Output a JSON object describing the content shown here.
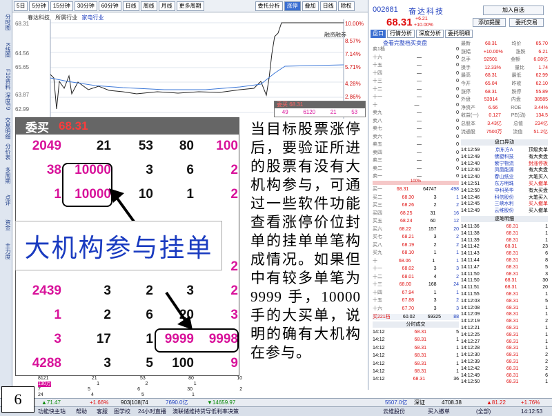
{
  "toolbar": {
    "buttons": [
      "分时",
      "5日",
      "5分钟",
      "15分钟",
      "30分钟",
      "60分钟",
      "日线",
      "周线",
      "月线",
      "更多周期"
    ],
    "right_buttons": [
      "委托分析",
      "涨停",
      "叠加",
      "日线",
      "除权"
    ]
  },
  "left_tabs": [
    "应用",
    "分时图",
    "K线图",
    "F10资料",
    "深度F9",
    "交易明细",
    "分价表",
    "多周期",
    "点评",
    "资金",
    "主力度"
  ],
  "chart": {
    "header": [
      "春达科技",
      "所属行业",
      "家电行业"
    ],
    "price_axis": [
      "68.31",
      "66.48",
      "64.66",
      "62.83",
      "60.95",
      "59.12",
      "57.30"
    ],
    "pct_axis": [
      "10.00%",
      "7.14%",
      "5.71%",
      "4.28%",
      "2.86%"
    ],
    "left_axis_shown": [
      "68.31",
      "66.48",
      "64.56",
      "65.65",
      "63.87",
      "62.99"
    ],
    "right_axis_shown": [
      "10.00%",
      "8.57%",
      "7.14%",
      "5.71%",
      "4.28%",
      "2.86%"
    ],
    "overlay_label": "融资融券",
    "mini_header": "委买  68.31",
    "mini_row": [
      "49",
      "6120",
      "21",
      "53"
    ]
  },
  "stock": {
    "code": "002681",
    "name": "奋达科技",
    "price": "68.31",
    "change": "+6.21",
    "change_pct": "+10.00%",
    "buttons": [
      "加入自选",
      "添加提醒",
      "委托交易"
    ],
    "tabs": [
      "盘口",
      "行情分析",
      "深度分析",
      "委托明细"
    ],
    "detail_link": "查看完整档买卖盘"
  },
  "order_book": {
    "sell_rows": [
      {
        "label": "卖1档",
        "price": "",
        "vol": "0",
        "sz": ""
      },
      {
        "label": "十六",
        "price": "—",
        "vol": "0",
        "sz": ""
      },
      {
        "label": "十五",
        "price": "—",
        "vol": "0",
        "sz": ""
      },
      {
        "label": "十四",
        "price": "—",
        "vol": "0",
        "sz": ""
      },
      {
        "label": "十三",
        "price": "—",
        "vol": "0",
        "sz": ""
      },
      {
        "label": "十二",
        "price": "—",
        "vol": "0",
        "sz": ""
      },
      {
        "label": "十一",
        "price": "—",
        "vol": "0",
        "sz": ""
      },
      {
        "label": "十",
        "price": "—",
        "vol": "0",
        "sz": ""
      },
      {
        "label": "卖九",
        "price": "—",
        "vol": "0",
        "sz": ""
      },
      {
        "label": "卖八",
        "price": "—",
        "vol": "0",
        "sz": ""
      },
      {
        "label": "卖七",
        "price": "—",
        "vol": "0",
        "sz": ""
      },
      {
        "label": "卖六",
        "price": "—",
        "vol": "0",
        "sz": ""
      },
      {
        "label": "卖五",
        "price": "—",
        "vol": "0",
        "sz": ""
      },
      {
        "label": "卖四",
        "price": "—",
        "vol": "0",
        "sz": ""
      },
      {
        "label": "卖三",
        "price": "—",
        "vol": "0",
        "sz": ""
      },
      {
        "label": "卖二",
        "price": "—",
        "vol": "0",
        "sz": ""
      },
      {
        "label": "卖一",
        "price": "—",
        "vol": "0",
        "sz": ""
      }
    ],
    "mid_label": "100%",
    "buy_rows": [
      {
        "label": "买一",
        "price": "68.31",
        "vol": "64747",
        "sz": "498"
      },
      {
        "label": "买二",
        "price": "68.30",
        "vol": "3",
        "sz": "1"
      },
      {
        "label": "买三",
        "price": "68.26",
        "vol": "2",
        "sz": "2"
      },
      {
        "label": "买四",
        "price": "68.25",
        "vol": "31",
        "sz": "16"
      },
      {
        "label": "买五",
        "price": "68.24",
        "vol": "60",
        "sz": "12"
      },
      {
        "label": "买六",
        "price": "68.22",
        "vol": "157",
        "sz": "20"
      },
      {
        "label": "买七",
        "price": "68.21",
        "vol": "3",
        "sz": "2"
      },
      {
        "label": "买八",
        "price": "68.19",
        "vol": "2",
        "sz": "2"
      },
      {
        "label": "买九",
        "price": "68.10",
        "vol": "1",
        "sz": "1"
      },
      {
        "label": "十",
        "price": "68.06",
        "vol": "1",
        "sz": "1"
      },
      {
        "label": "十一",
        "price": "68.02",
        "vol": "3",
        "sz": "3"
      },
      {
        "label": "十二",
        "price": "68.01",
        "vol": "4",
        "sz": "2"
      },
      {
        "label": "十三",
        "price": "68.00",
        "vol": "168",
        "sz": "24"
      },
      {
        "label": "十四",
        "price": "67.94",
        "vol": "1",
        "sz": "1"
      },
      {
        "label": "十五",
        "price": "67.88",
        "vol": "3",
        "sz": "2"
      },
      {
        "label": "十六",
        "price": "67.70",
        "vol": "3",
        "sz": "3"
      }
    ],
    "total_row": [
      "买221档",
      "60.02",
      "69325",
      "88"
    ]
  },
  "quote_stats": [
    [
      "最新",
      "68.31",
      "均价",
      "65.70"
    ],
    [
      "涨幅",
      "+10.00%",
      "涨跌",
      "6.21"
    ],
    [
      "总手",
      "92501",
      "金额",
      "6.08亿"
    ],
    [
      "换手",
      "12.33%",
      "量比",
      "1.74"
    ],
    [
      "最高",
      "68.31",
      "最低",
      "62.99"
    ],
    [
      "今开",
      "65.04",
      "昨收",
      "62.10"
    ],
    [
      "涨停",
      "68.31",
      "跌停",
      "55.89"
    ],
    [
      "外盘",
      "53914",
      "内盘",
      "38585"
    ],
    [
      "净资产",
      "6.66",
      "ROE",
      "3.44%"
    ],
    [
      "收益(一)",
      "0.127",
      "PE(动)",
      "134.5"
    ],
    [
      "总股本",
      "3.43亿",
      "总值",
      "234亿"
    ],
    [
      "流通股",
      "7500万",
      "流值",
      "51.2亿"
    ]
  ],
  "pankou_title": "盘口异动",
  "pankou": [
    [
      "14:12:59",
      "京东方A",
      "顶级卖单"
    ],
    [
      "14:12:49",
      "佛塑科技",
      "有大卖盘"
    ],
    [
      "14:12:40",
      "紫宁物流",
      "封涨停板"
    ],
    [
      "14:12:40",
      "凤凰能源",
      "有大卖盘"
    ],
    [
      "14:12:40",
      "春山纸业",
      "大笔买入"
    ],
    [
      "14:12:51",
      "东方明珠",
      "买入撤单"
    ],
    [
      "14:12:50",
      "中科英华",
      "有大买盘"
    ],
    [
      "14:12:46",
      "科信股份",
      "大笔买入"
    ],
    [
      "14:12:45",
      "三峡水利",
      "买入撤单"
    ],
    [
      "14:12:49",
      "云维股份",
      "买入撤单"
    ]
  ],
  "ticks_title": "逐笔明细",
  "ticks": [
    [
      "14:11:36",
      "68.31",
      "1"
    ],
    [
      "14:11:38",
      "68.31",
      "1"
    ],
    [
      "14:11:39",
      "68.31",
      "1"
    ],
    [
      "14:11:42",
      "68.31",
      "23"
    ],
    [
      "14:11:43",
      "68.31",
      "6"
    ],
    [
      "14:11:44",
      "68.31",
      "8"
    ],
    [
      "14:11:47",
      "68.31",
      "5"
    ],
    [
      "14:11:50",
      "68.31",
      "3"
    ],
    [
      "14:11:50",
      "68.31",
      "30"
    ],
    [
      "14:11:51",
      "68.31",
      "20"
    ],
    [
      "14:11:55",
      "68.31",
      "1"
    ],
    [
      "14:12:03",
      "68.31",
      "5"
    ],
    [
      "14:12:08",
      "68.31",
      "1"
    ],
    [
      "14:12:09",
      "68.31",
      "1"
    ],
    [
      "14:12:19",
      "68.31",
      "2"
    ],
    [
      "14:12:21",
      "68.31",
      "1"
    ],
    [
      "14:12:25",
      "68.31",
      "1"
    ],
    [
      "14:12:27",
      "68.31",
      "1"
    ],
    [
      "14:12:28",
      "68.31",
      "1"
    ],
    [
      "14:12:30",
      "68.31",
      "2"
    ],
    [
      "14:12:39",
      "68.31",
      "2"
    ],
    [
      "14:12:42",
      "68.31",
      "2"
    ],
    [
      "14:12:49",
      "68.31",
      "6"
    ],
    [
      "14:12:50",
      "68.31",
      "1"
    ]
  ],
  "fenshi_title": "分时成交",
  "fenshi_rows": [
    [
      "14:12",
      "68.31",
      "5"
    ],
    [
      "14:12",
      "68.31",
      "1"
    ],
    [
      "14:12",
      "68.31",
      "1"
    ],
    [
      "14:12",
      "68.31",
      "1"
    ],
    [
      "14:12",
      "68.31",
      "1"
    ],
    [
      "14:12",
      "68.31",
      "1"
    ],
    [
      "14:12",
      "68.31",
      "36"
    ]
  ],
  "weimai": {
    "title": "委买",
    "price": "68.31",
    "rows": [
      [
        "2049",
        "21",
        "53",
        "80",
        "100"
      ],
      [
        "38",
        "10000",
        "3",
        "6",
        "2"
      ],
      [
        "1",
        "10000",
        "10",
        "1",
        "2"
      ],
      [
        "",
        "",
        "",
        "",
        ""
      ],
      [
        "",
        "",
        "",
        "",
        ""
      ],
      [
        "16",
        "3",
        "20",
        "39",
        "2"
      ],
      [
        "2439",
        "3",
        "2",
        "3",
        "2"
      ],
      [
        "1",
        "2",
        "6",
        "20",
        "3"
      ],
      [
        "3",
        "17",
        "1",
        "9999",
        "9998"
      ],
      [
        "4288",
        "3",
        "5",
        "100",
        "9"
      ]
    ]
  },
  "callout": "大机构参与挂单",
  "explanation": "当目标股票涨停后，要验证所进的股票有没有大机构参与，可通过一些软件功能查看涨停价位封单的挂单单笔构成情况。如果但中有较多单笔为 9999 手，10000 手的大买单，说明的确有大机构在参与。",
  "page_number": "6",
  "statusbar": {
    "items": [
      "▲71.47",
      "+1.66%",
      "903|108|74",
      "7690.0亿",
      "▼14659.97"
    ],
    "right_items": [
      "5507.0亿",
      "深证",
      "4708.38",
      "▲81.22",
      "+1.76%"
    ]
  },
  "bottombar": {
    "items": [
      "功能快主站",
      "帮助",
      "客服",
      "图学校",
      "24小时直播",
      "澳联储维持贷导低利率决策",
      "云维股份",
      "买入撤单",
      "(全部)",
      "14:12:53"
    ]
  },
  "left_mini_table": {
    "rows": [
      [
        "8121",
        "21",
        "53",
        "80",
        "100"
      ],
      [
        "130万",
        "1",
        "2",
        "1",
        "3"
      ],
      [
        "7",
        "5",
        "6",
        "30",
        "21"
      ],
      [
        "24",
        "4",
        "5",
        "1",
        "5"
      ]
    ]
  }
}
